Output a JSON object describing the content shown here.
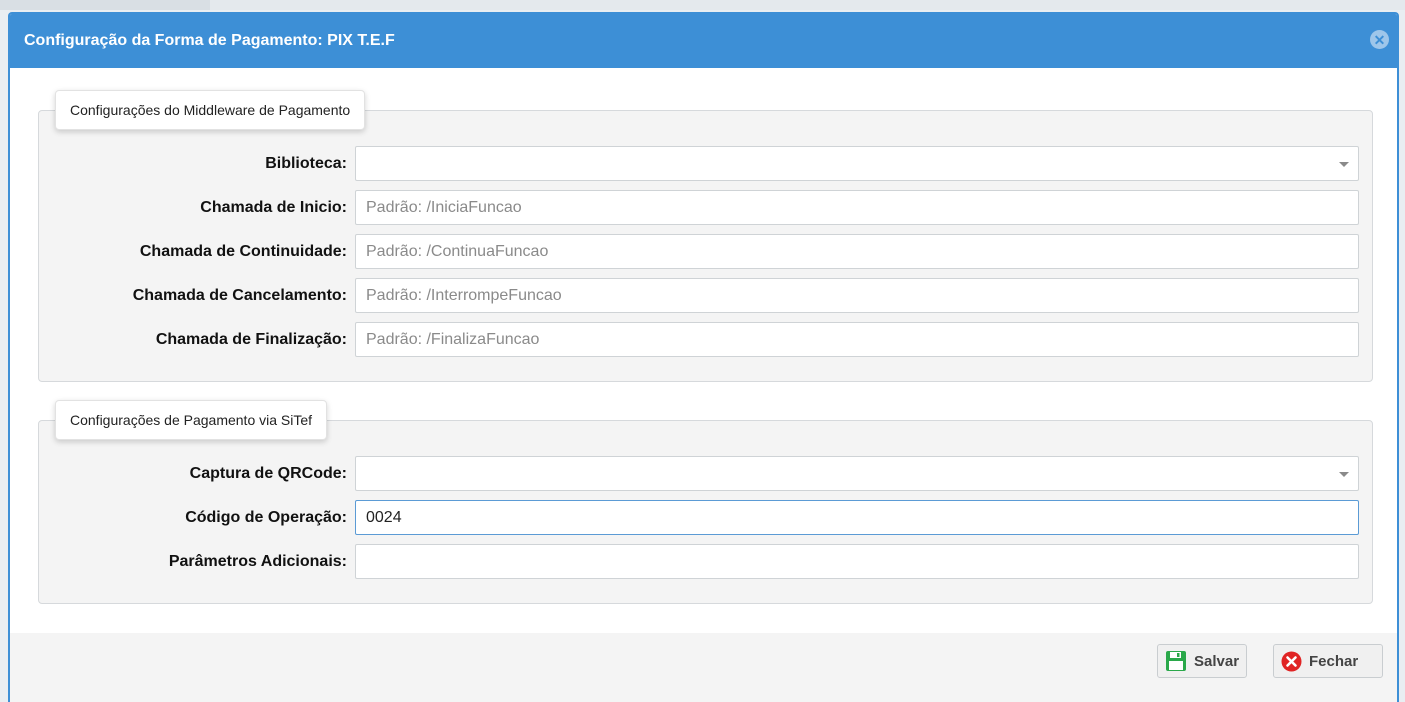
{
  "dialog": {
    "title": "Configuração da Forma de Pagamento: PIX T.E.F",
    "close_icon": "close-icon"
  },
  "middleware": {
    "legend": "Configurações do Middleware de Pagamento",
    "fields": [
      {
        "label": "Biblioteca:",
        "type": "select",
        "value": "",
        "placeholder": ""
      },
      {
        "label": "Chamada de Inicio:",
        "type": "input",
        "value": "",
        "placeholder": "Padrão: /IniciaFuncao"
      },
      {
        "label": "Chamada de Continuidade:",
        "type": "input",
        "value": "",
        "placeholder": "Padrão: /ContinuaFuncao"
      },
      {
        "label": "Chamada de Cancelamento:",
        "type": "input",
        "value": "",
        "placeholder": "Padrão: /InterrompeFuncao"
      },
      {
        "label": "Chamada de Finalização:",
        "type": "input",
        "value": "",
        "placeholder": "Padrão: /FinalizaFuncao"
      }
    ]
  },
  "sitef": {
    "legend": "Configurações de Pagamento via SiTef",
    "fields": [
      {
        "label": "Captura de QRCode:",
        "type": "select",
        "value": "",
        "placeholder": ""
      },
      {
        "label": "Código de Operação:",
        "type": "input",
        "value": "0024",
        "placeholder": ""
      },
      {
        "label": "Parâmetros Adicionais:",
        "type": "input",
        "value": "",
        "placeholder": ""
      }
    ]
  },
  "footer": {
    "save_label": "Salvar",
    "close_label": "Fechar",
    "save_icon": "save-icon",
    "close_icon": "close-circle-icon"
  },
  "colors": {
    "titlebar": "#3d8fd6",
    "save_icon": "#2aa84a",
    "close_icon": "#e02424"
  }
}
